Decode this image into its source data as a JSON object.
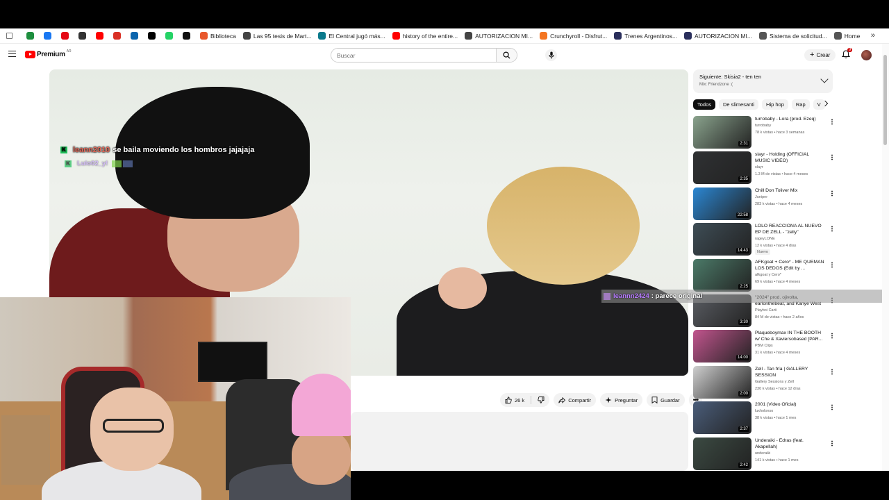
{
  "bookmarks": [
    {
      "label": "",
      "icon": "drive-icon",
      "color": "#1e8e3e"
    },
    {
      "label": "",
      "icon": "facebook-icon",
      "color": "#1877f2"
    },
    {
      "label": "",
      "icon": "netflix-icon",
      "color": "#e50914"
    },
    {
      "label": "",
      "icon": "circle-icon",
      "color": "#333333"
    },
    {
      "label": "",
      "icon": "youtube-icon",
      "color": "#ff0000"
    },
    {
      "label": "",
      "icon": "gmail-icon",
      "color": "#d93025"
    },
    {
      "label": "",
      "icon": "outlook-icon",
      "color": "#0a64ad"
    },
    {
      "label": "",
      "icon": "x-icon",
      "color": "#000000"
    },
    {
      "label": "",
      "icon": "whatsapp-icon",
      "color": "#25d366"
    },
    {
      "label": "",
      "icon": "s-icon",
      "color": "#111111"
    },
    {
      "label": "Biblioteca",
      "icon": "biblioteca-icon",
      "color": "#e8572c"
    },
    {
      "label": "Las 95 tesis de Mart...",
      "icon": "wikipedia-icon",
      "color": "#444444"
    },
    {
      "label": "El Central jugó más...",
      "icon": "bookmark-icon",
      "color": "#0b7a8c"
    },
    {
      "label": "history of the entire...",
      "icon": "youtube-icon",
      "color": "#ff0000"
    },
    {
      "label": "AUTORIZACION MI...",
      "icon": "globe-icon",
      "color": "#444444"
    },
    {
      "label": "Crunchyroll - Disfrut...",
      "icon": "crunchyroll-icon",
      "color": "#f47521"
    },
    {
      "label": "Trenes Argentinos...",
      "icon": "bookmark-icon",
      "color": "#2a2f5c"
    },
    {
      "label": "AUTORIZACION MI...",
      "icon": "bookmark-icon",
      "color": "#2a2f5c"
    },
    {
      "label": "Sistema de solicitud...",
      "icon": "folder-icon",
      "color": "#555555"
    },
    {
      "label": "Home",
      "icon": "home-icon",
      "color": "#555555"
    }
  ],
  "masthead": {
    "logo_text": "Premium",
    "logo_region": "AR",
    "search_placeholder": "Buscar",
    "create_label": "Crear",
    "notifications_count": "9"
  },
  "player": {
    "chat_main": {
      "user": "leann2010",
      "message": "se baila moviendo los hombros jajajaja"
    },
    "chat_faded": {
      "user": "Lulo02_y!",
      "message": ""
    }
  },
  "overlay_chat": {
    "user": "leannn2424",
    "message": ": parece original"
  },
  "actions": {
    "like_count": "26 k",
    "share_label": "Compartir",
    "ask_label": "Preguntar",
    "save_label": "Guardar"
  },
  "up_next": {
    "title": "Siguiente: Skisia2 - ten ten",
    "subtitle": "Mix: Friendzone :("
  },
  "chips": [
    "Todos",
    "De slimesanti",
    "Hip hop",
    "Rap",
    "V"
  ],
  "recommendations": [
    {
      "title": "turrobaby - Lora (prod. Ezeq)",
      "channel": "turrobaby",
      "meta": "78 k vistas • hace 3 semanas",
      "duration": "2:31",
      "thumb": "#8aa38d"
    },
    {
      "title": "slayr - Holding (OFFICIAL MUSIC VIDEO)",
      "channel": "slayr",
      "meta": "1.3 M de vistas • hace 4 meses",
      "duration": "2:35",
      "thumb": "#2f3133"
    },
    {
      "title": "Chill Don Toliver Mix",
      "channel": "Juniper",
      "meta": "283 k vistas • hace 4 meses",
      "duration": "22:58",
      "thumb": "#2b87d3"
    },
    {
      "title": "LOLO REACCIONA AL NUEVO EP DE ZELL - \"zelly\"",
      "channel": "rageyLONE",
      "meta": "12 k vistas • hace 4 días",
      "badge": "Nuevo",
      "duration": "14:43",
      "thumb": "#3e4d56"
    },
    {
      "title": "AFKgoat + Cero* - ME QUEMAN LOS DEDOS (Edit by ...",
      "channel": "afkgoat y Cero*",
      "meta": "69 k vistas • hace 4 meses",
      "duration": "2:25",
      "thumb": "#4b7a68"
    },
    {
      "title": "\"2024\" prod. ojivolta, earlonthebeat, and Kanye West",
      "channel": "Playboi Carti",
      "meta": "84 M de vistas • hace 2 años",
      "duration": "3:30",
      "thumb": "#5a5d63"
    },
    {
      "title": "Plaqueboymax IN THE BOOTH w/ Che & Xaviersobased [PAR...",
      "channel": "PBM Clips",
      "meta": "31 k vistas • hace 4 meses",
      "duration": "14:00",
      "thumb": "#c2558e"
    },
    {
      "title": "Zell - Tan fría | GALLERY SESSION",
      "channel": "Gallery Sessions y Zell",
      "meta": "230 k vistas • hace 12 días",
      "duration": "2:00",
      "thumb": "#cfcfcf"
    },
    {
      "title": "2001 (Video Oficial)",
      "channel": "luxholonso",
      "meta": "38 k vistas • hace 1 mes",
      "duration": "2:37",
      "thumb": "#4a5d7a"
    },
    {
      "title": "Underaiki - Edras (feat. Akapellah)",
      "channel": "underaiki",
      "meta": "141 k vistas • hace 1 mes",
      "duration": "2:42",
      "thumb": "#3b4a42"
    }
  ]
}
